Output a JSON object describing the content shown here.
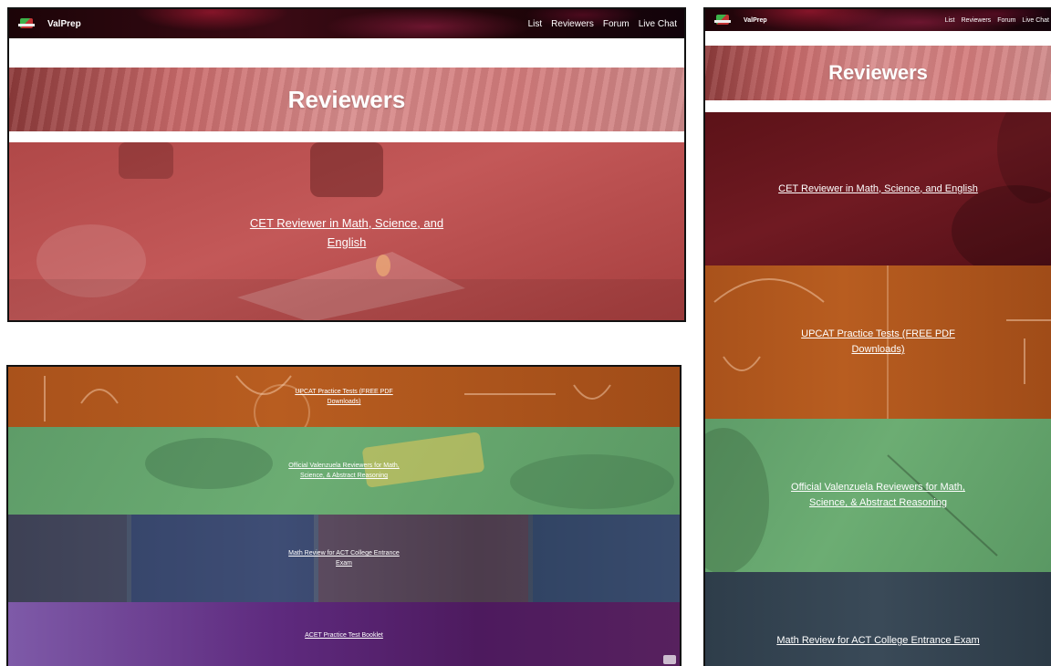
{
  "brand": "ValPrep",
  "nav": [
    "List",
    "Reviewers",
    "Forum",
    "Live Chat"
  ],
  "hero_title": "Reviewers",
  "reviewers": [
    "CET Reviewer in Math, Science, and English",
    "UPCAT Practice Tests (FREE PDF Downloads)",
    "Official Valenzuela Reviewers for Math, Science, & Abstract Reasoning",
    "Math Review for ACT College Entrance Exam",
    "ACET Practice Test Booklet"
  ],
  "colors": {
    "cet": "#b04848",
    "upcat": "#a9521b",
    "valenzuela": "#5e9c68",
    "act": "#3e4a5e",
    "acet": "#5e2a7e"
  }
}
